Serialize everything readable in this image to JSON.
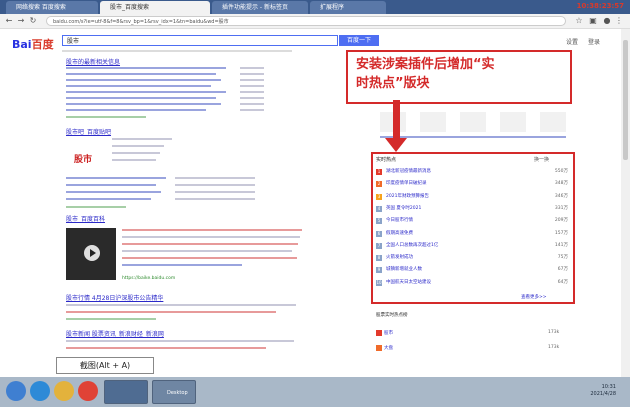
{
  "browser": {
    "tabs": [
      "网络搜索 百度搜索",
      "股市_百度搜索",
      "插件功能提示 - 新标签页",
      "扩展程序"
    ],
    "clock": "10:38:23:57",
    "url": "baidu.com/s?ie=utf-8&f=8&rsv_bp=1&rsv_idx=1&tn=baidu&wd=股市"
  },
  "search": {
    "logo_a": "Bai",
    "logo_b": "百度",
    "query": "股市",
    "button": "百度一下",
    "header_links": [
      "设置",
      "登录"
    ]
  },
  "results": [
    {
      "title": "股市的最新相关信息"
    },
    {
      "title": "股市吧_百度贴吧"
    },
    {
      "title": "股市_百度百科"
    },
    {
      "title": "股市行情 4月28日沪深股市公告精华"
    },
    {
      "title": "股市新闻 股票资讯_新浪财经_新浪网"
    }
  ],
  "promo": {
    "logo": "股市"
  },
  "source_links": {
    "baike": "https://baike.baidu.com"
  },
  "annotation": {
    "line1": "安装涉案插件后增加“实",
    "line2": "时热点”版块"
  },
  "hot": {
    "title": "实时热点",
    "more_label": "换一换",
    "footer": "查看更多>>",
    "items": [
      {
        "text": "湖北新冠疫情最新消息",
        "count": "550万",
        "color": "#e33a2b"
      },
      {
        "text": "印度疫情单日破纪录",
        "count": "348万",
        "color": "#f06b2a"
      },
      {
        "text": "2021年财政预算报告",
        "count": "346万",
        "color": "#f6a21e"
      },
      {
        "text": "英国 夏令时2021",
        "count": "331万",
        "color": "#8aa3c8"
      },
      {
        "text": "今日股市行情",
        "count": "209万",
        "color": "#8aa3c8"
      },
      {
        "text": "假期高速免费",
        "count": "157万",
        "color": "#8aa3c8"
      },
      {
        "text": "全国人口总数再次超过1亿",
        "count": "141万",
        "color": "#8aa3c8"
      },
      {
        "text": "火箭发射成功",
        "count": "75万",
        "color": "#8aa3c8"
      },
      {
        "text": "城镇新增就业人数",
        "count": "67万",
        "color": "#8aa3c8"
      },
      {
        "text": "中国航天日太空站建设",
        "count": "64万",
        "color": "#8aa3c8"
      }
    ]
  },
  "side_bottom": {
    "title": "股票实时热点榜",
    "rows": [
      {
        "label": "股市",
        "count": "173k"
      },
      {
        "label": "大盘",
        "count": "173k"
      }
    ]
  },
  "hint": "截图(Alt + A)",
  "taskbar": {
    "window": "Desktop",
    "time": "10:31",
    "date": "2021/4/28"
  }
}
